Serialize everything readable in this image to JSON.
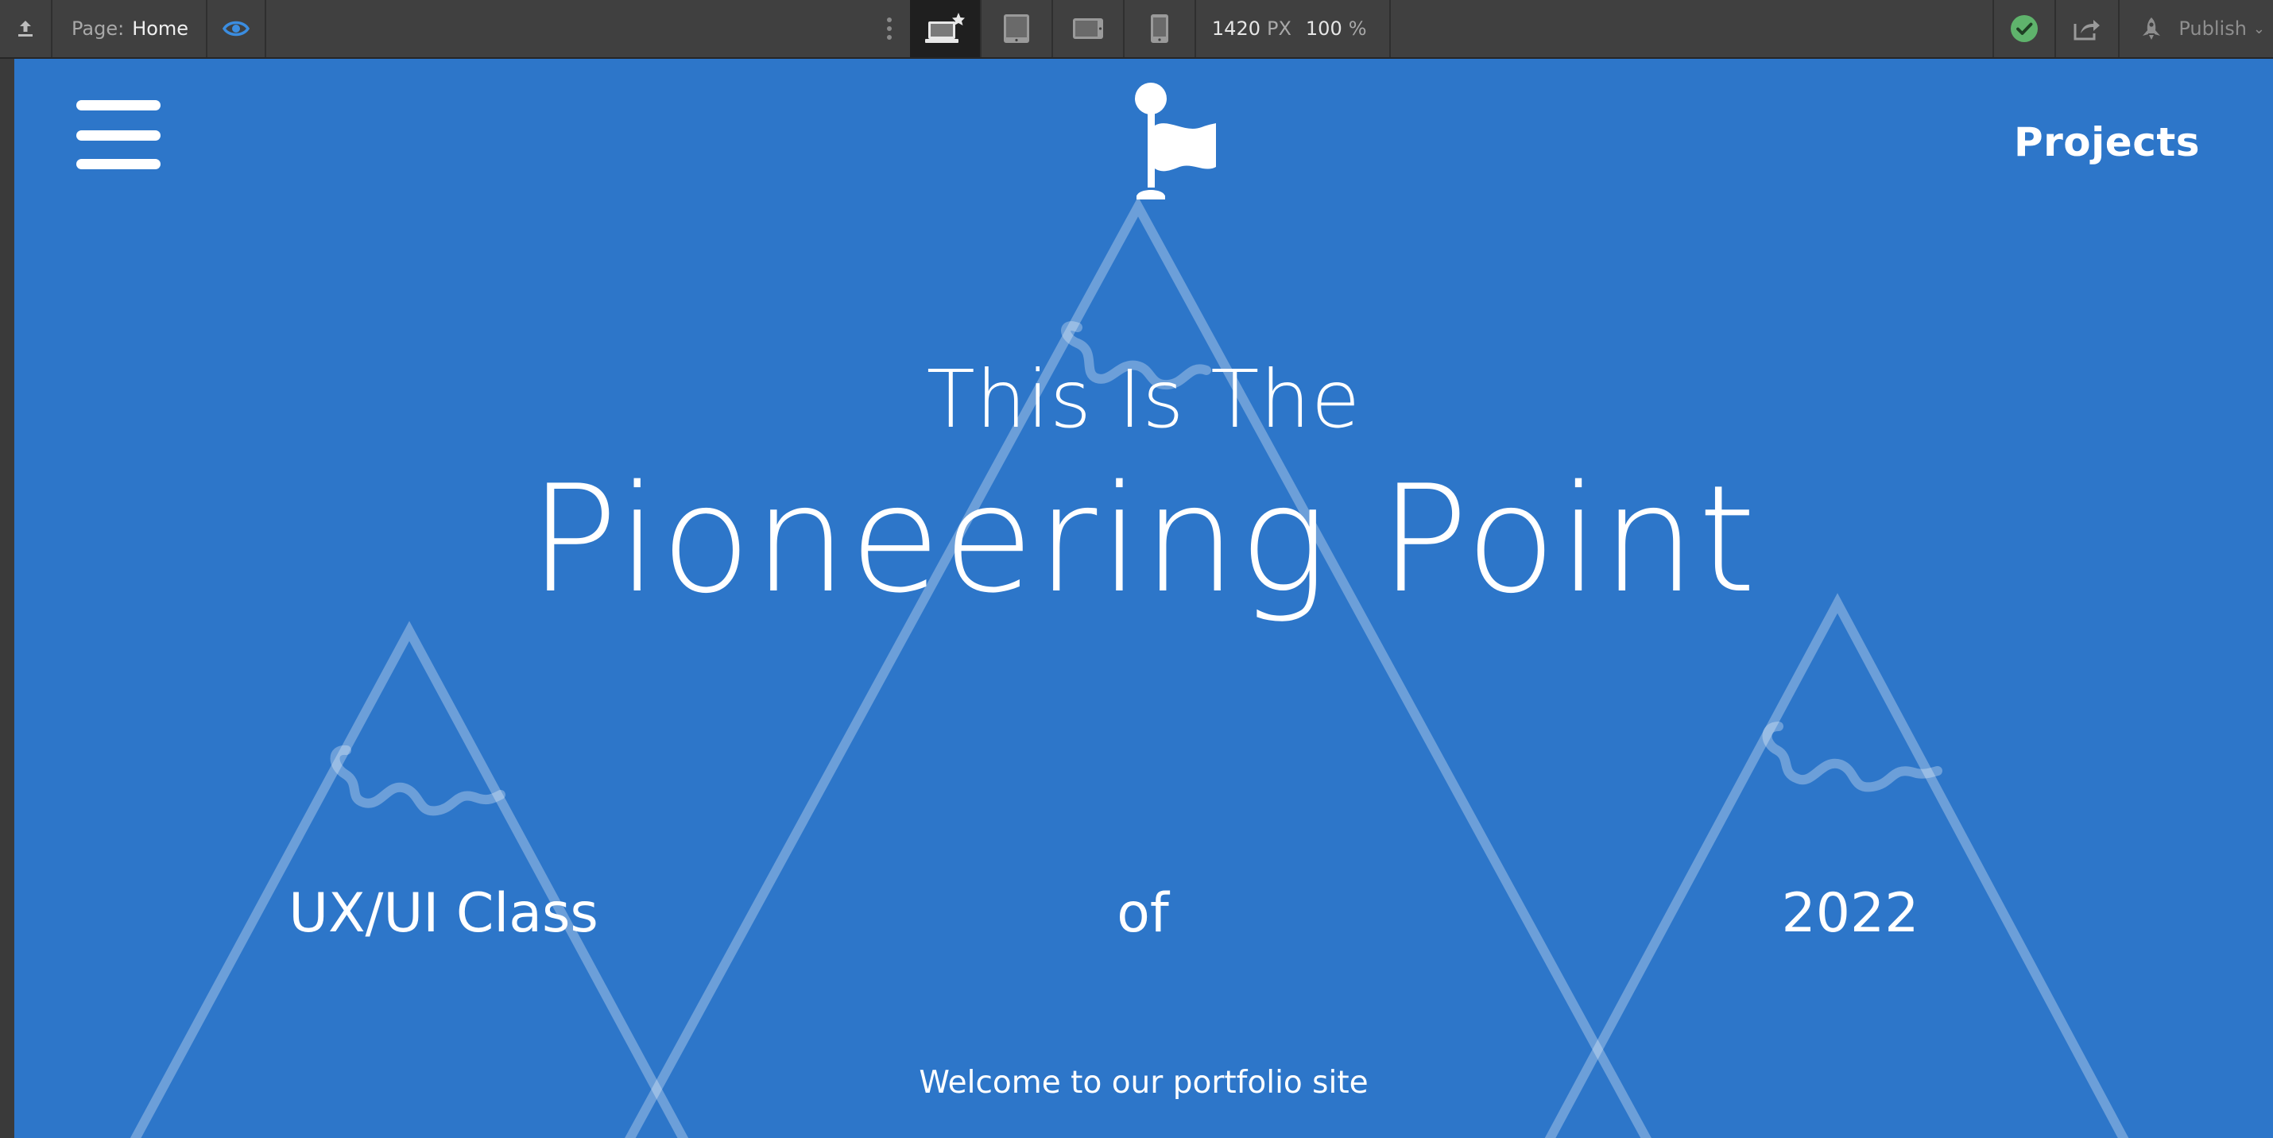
{
  "toolbar": {
    "page_label": "Page:",
    "page_value": "Home",
    "width_value": "1420",
    "width_unit": "PX",
    "zoom_value": "100",
    "zoom_unit": "%",
    "publish_label": "Publish",
    "icons": [
      "upload-icon",
      "eye-icon",
      "more-dots-icon",
      "desktop-device-icon",
      "tablet-device-icon",
      "tablet-landscape-device-icon",
      "phone-device-icon",
      "check-circle-icon",
      "share-icon",
      "rocket-icon",
      "chevron-down-icon"
    ],
    "active_device": "desktop",
    "status_color": "#5fb36c",
    "eye_color": "#3b8de0"
  },
  "site": {
    "background_color": "#2d76c9",
    "nav": {
      "menu_icon": "hamburger-menu-icon",
      "logo_icon": "flag-icon",
      "projects_link": "Projects"
    },
    "hero": {
      "line1": "This Is The",
      "line2": "Pioneering Point"
    },
    "tagline": {
      "word1": "UX/UI Class",
      "word2": "of",
      "word3": "2022"
    },
    "welcome": "Welcome to our portfolio site"
  }
}
